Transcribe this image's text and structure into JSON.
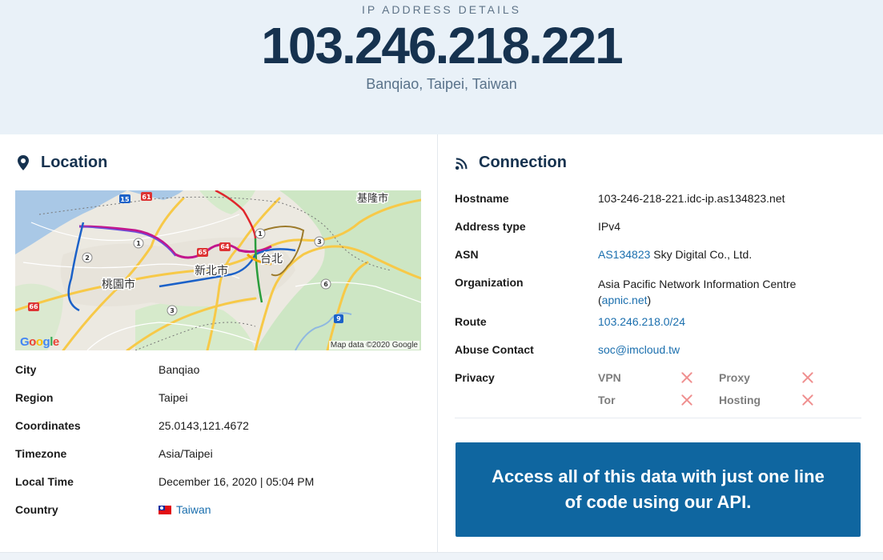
{
  "hero": {
    "eyebrow": "IP ADDRESS DETAILS",
    "ip": "103.246.218.221",
    "location": "Banqiao, Taipei, Taiwan"
  },
  "location_card": {
    "title": "Location",
    "icon": "map-pin-icon",
    "map": {
      "attribution": "Map data ©2020 Google",
      "logo": [
        "G",
        "o",
        "o",
        "g",
        "l",
        "e"
      ],
      "labels": [
        "桃園市",
        "新北市",
        "台北",
        "基隆市"
      ],
      "route_shields": [
        "15",
        "61",
        "1",
        "2",
        "65",
        "64",
        "1",
        "3",
        "3",
        "66",
        "6",
        "9"
      ]
    },
    "fields": [
      {
        "label": "City",
        "value": "Banqiao"
      },
      {
        "label": "Region",
        "value": "Taipei"
      },
      {
        "label": "Coordinates",
        "value": "25.0143,121.4672"
      },
      {
        "label": "Timezone",
        "value": "Asia/Taipei"
      },
      {
        "label": "Local Time",
        "value": "December 16, 2020 | 05:04 PM"
      },
      {
        "label": "Country",
        "value": "Taiwan"
      }
    ]
  },
  "connection_card": {
    "title": "Connection",
    "icon": "wifi-signal-icon",
    "hostname": {
      "label": "Hostname",
      "value": "103-246-218-221.idc-ip.as134823.net"
    },
    "address_type": {
      "label": "Address type",
      "value": "IPv4"
    },
    "asn": {
      "label": "ASN",
      "link": "AS134823",
      "text": " Sky Digital Co., Ltd."
    },
    "organization": {
      "label": "Organization",
      "line1": "Asia Pacific Network Information Centre",
      "line2_prefix": "(",
      "line2_link": "apnic.net",
      "line2_suffix": ")"
    },
    "route": {
      "label": "Route",
      "value": "103.246.218.0/24"
    },
    "abuse": {
      "label": "Abuse Contact",
      "value": "soc@imcloud.tw"
    },
    "privacy": {
      "label": "Privacy",
      "items": [
        {
          "name": "VPN",
          "status": false
        },
        {
          "name": "Proxy",
          "status": false
        },
        {
          "name": "Tor",
          "status": false
        },
        {
          "name": "Hosting",
          "status": false
        }
      ]
    }
  },
  "api_banner": {
    "text": "Access all of this data with just one line of code using our API."
  },
  "colors": {
    "hero_bg": "#e9f1f8",
    "ip_text": "#16324f",
    "link": "#1b6fae",
    "api_bg": "#0f66a0",
    "x_mark": "#ef8f8f"
  }
}
